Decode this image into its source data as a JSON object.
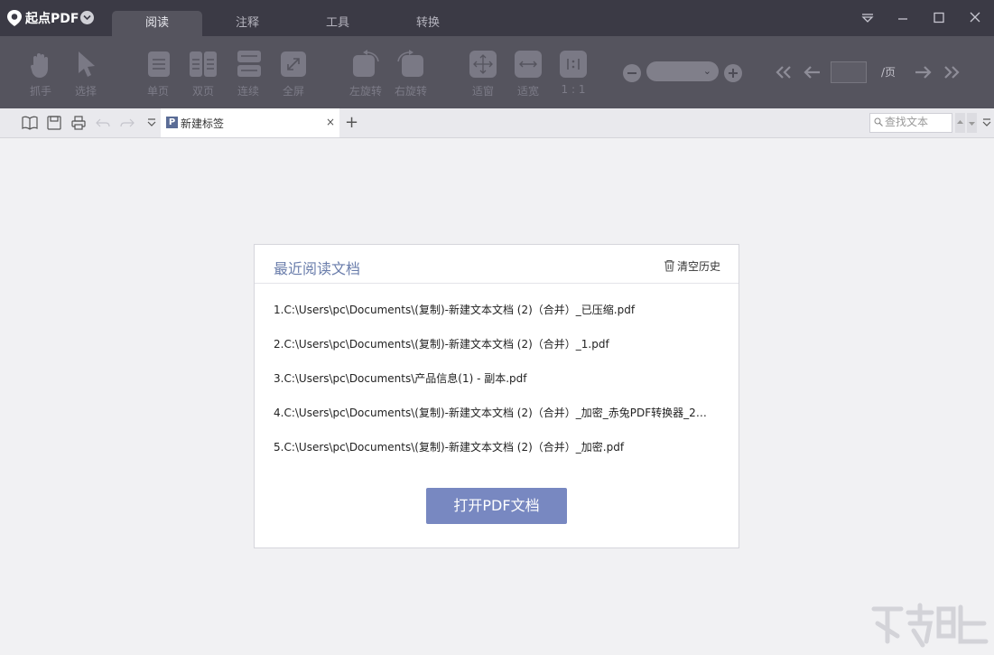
{
  "app": {
    "name": "起点PDF"
  },
  "tabs": [
    {
      "label": "阅读",
      "active": true
    },
    {
      "label": "注释",
      "active": false
    },
    {
      "label": "工具",
      "active": false
    },
    {
      "label": "转换",
      "active": false
    }
  ],
  "toolbar": {
    "tools": [
      {
        "label": "抓手",
        "icon": "hand-icon"
      },
      {
        "label": "选择",
        "icon": "cursor-icon"
      },
      {
        "label": "单页",
        "icon": "single-page-icon"
      },
      {
        "label": "双页",
        "icon": "double-page-icon"
      },
      {
        "label": "连续",
        "icon": "continuous-icon"
      },
      {
        "label": "全屏",
        "icon": "fullscreen-icon"
      },
      {
        "label": "左旋转",
        "icon": "rotate-left-icon"
      },
      {
        "label": "右旋转",
        "icon": "rotate-right-icon"
      },
      {
        "label": "适窗",
        "icon": "fit-window-icon"
      },
      {
        "label": "适宽",
        "icon": "fit-width-icon"
      },
      {
        "label": "1 : 1",
        "icon": "actual-size-icon"
      }
    ],
    "page_suffix": "/页"
  },
  "doc_tab": {
    "label": "新建标签",
    "icon_letter": "P",
    "close": "×",
    "add": "+"
  },
  "search": {
    "placeholder": "查找文本"
  },
  "recent": {
    "title": "最近阅读文档",
    "clear_label": "清空历史",
    "items": [
      "1.C:\\Users\\pc\\Documents\\(复制)-新建文本文档 (2)（合并）_已压缩.pdf",
      "2.C:\\Users\\pc\\Documents\\(复制)-新建文本文档 (2)（合并）_1.pdf",
      "3.C:\\Users\\pc\\Documents\\产品信息(1) - 副本.pdf",
      "4.C:\\Users\\pc\\Documents\\(复制)-新建文本文档 (2)（合并）_加密_赤兔PDF转换器_20...",
      "5.C:\\Users\\pc\\Documents\\(复制)-新建文本文档 (2)（合并）_加密.pdf"
    ],
    "open_button": "打开PDF文档"
  },
  "colors": {
    "titlebar": "#3b3a45",
    "toolbar": "#55545e",
    "accent": "#7888c1",
    "title_text": "#6a7dab"
  }
}
